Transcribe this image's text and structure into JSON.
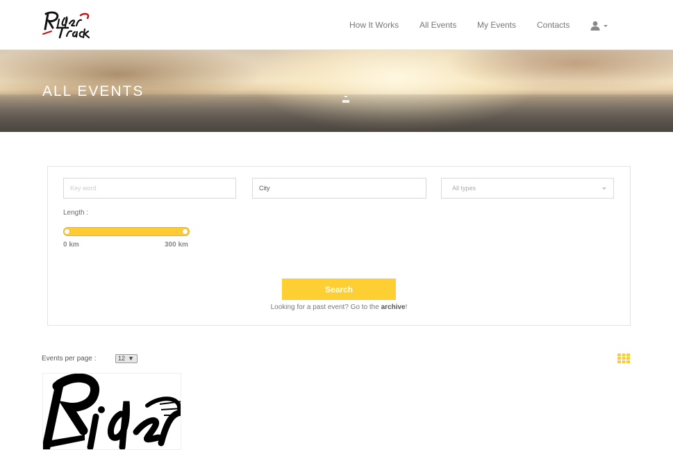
{
  "brand": {
    "name": "Rider Track"
  },
  "nav": {
    "items": [
      {
        "label": "How It Works"
      },
      {
        "label": "All Events"
      },
      {
        "label": "My Events"
      },
      {
        "label": "Contacts"
      }
    ],
    "user_icon": "user-icon"
  },
  "hero": {
    "title": "ALL EVENTS"
  },
  "search": {
    "keyword_placeholder": "Key word",
    "city_value": "City",
    "type_select": "All types",
    "length_label": "Length :",
    "length_min": "0 km",
    "length_max": "300 km",
    "length_range_km": [
      0,
      300
    ],
    "button_label": "Search",
    "archive_prefix": "Looking for a past event? Go to the ",
    "archive_link": "archive",
    "archive_suffix": "!"
  },
  "listing": {
    "per_page_label": "Events per page :",
    "per_page_value": "12",
    "view_icon": "grid-view-icon"
  },
  "colors": {
    "accent": "#fecf33",
    "nav_text": "#777777"
  }
}
